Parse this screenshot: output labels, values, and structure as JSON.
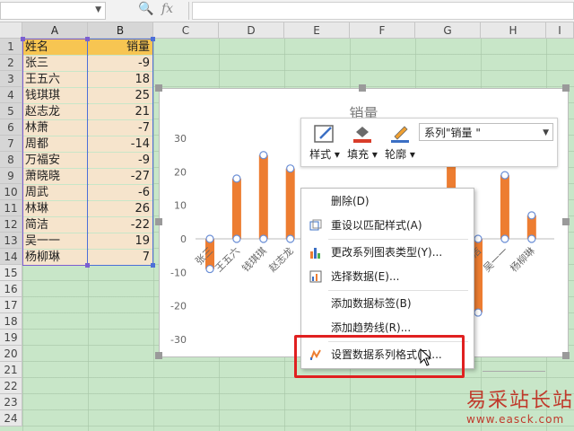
{
  "formula_bar": {
    "cell_name": "",
    "formula": "",
    "fx_label": "fx"
  },
  "columns": [
    "A",
    "B",
    "C",
    "D",
    "E",
    "F",
    "G",
    "H",
    "I"
  ],
  "rows": [
    "1",
    "2",
    "3",
    "4",
    "5",
    "6",
    "7",
    "8",
    "9",
    "10",
    "11",
    "12",
    "13",
    "14",
    "15",
    "16",
    "17",
    "18",
    "19",
    "20",
    "21",
    "22",
    "23",
    "24"
  ],
  "table": {
    "headers": [
      "姓名",
      "销量"
    ],
    "names": [
      "张三",
      "王五六",
      "钱琪琪",
      "赵志龙",
      "林萧",
      "周都",
      "万福安",
      "萧晓晓",
      "周武",
      "林琳",
      "简洁",
      "吴一一",
      "杨柳琳"
    ],
    "values": [
      "-9",
      "18",
      "25",
      "21",
      "-7",
      "-14",
      "-9",
      "-27",
      "-6",
      "26",
      "-22",
      "19",
      "7"
    ]
  },
  "chart": {
    "title": "销量",
    "y_ticks": [
      "30",
      "20",
      "10",
      "0",
      "-10",
      "-20",
      "-30"
    ],
    "x_labels_visible_left": [
      "张三",
      "王五六",
      "钱琪琪",
      "赵志龙"
    ],
    "x_labels_visible_right": [
      "简洁",
      "吴一一",
      "杨柳琳"
    ]
  },
  "chart_data": {
    "type": "line",
    "title": "销量",
    "categories": [
      "张三",
      "王五六",
      "钱琪琪",
      "赵志龙",
      "林萧",
      "周都",
      "万福安",
      "萧晓晓",
      "周武",
      "林琳",
      "简洁",
      "吴一一",
      "杨柳琳"
    ],
    "series": [
      {
        "name": "销量",
        "values": [
          -9,
          18,
          25,
          21,
          -7,
          -14,
          -9,
          -27,
          -6,
          26,
          -22,
          19,
          7
        ]
      }
    ],
    "ylim": [
      -35,
      35
    ],
    "color": "#ed7d31"
  },
  "mini_toolbar": {
    "style_label": "样式",
    "fill_label": "填充",
    "outline_label": "轮廓",
    "series_select": "系列\"销量 \""
  },
  "context_menu": {
    "items": [
      "删除(D)",
      "重设以匹配样式(A)",
      "更改系列图表类型(Y)...",
      "选择数据(E)...",
      "添加数据标签(B)",
      "添加趋势线(R)...",
      "设置数据系列格式(F)..."
    ]
  },
  "watermark": {
    "line1": "易采站长站",
    "line2": "www.easck.com"
  }
}
